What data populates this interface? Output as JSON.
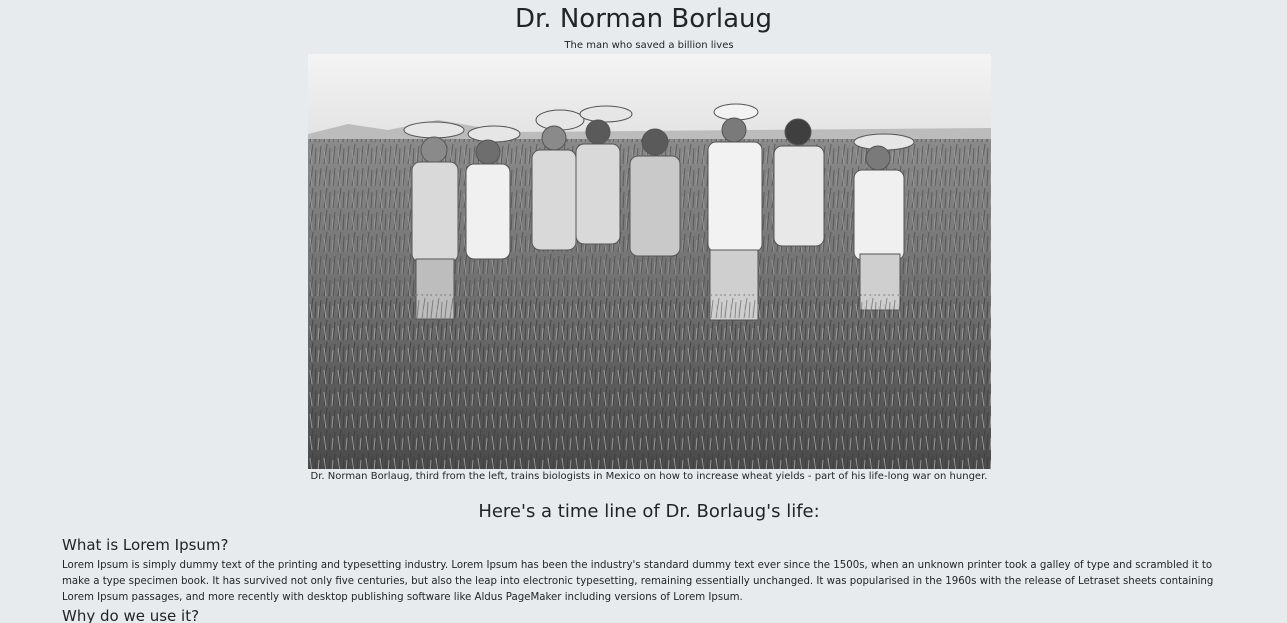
{
  "header": {
    "title": "Dr. Norman Borlaug",
    "subtitle": "The man who saved a billion lives"
  },
  "figure": {
    "caption": "Dr. Norman Borlaug, third from the left, trains biologists in Mexico on how to increase wheat yields - part of his life-long war on hunger."
  },
  "timeline": {
    "heading": "Here's a time line of Dr. Borlaug's life:",
    "sections": [
      {
        "heading": "What is Lorem Ipsum?",
        "body": "Lorem Ipsum is simply dummy text of the printing and typesetting industry. Lorem Ipsum has been the industry's standard dummy text ever since the 1500s, when an unknown printer took a galley of type and scrambled it to make a type specimen book. It has survived not only five centuries, but also the leap into electronic typesetting, remaining essentially unchanged. It was popularised in the 1960s with the release of Letraset sheets containing Lorem Ipsum passages, and more recently with desktop publishing software like Aldus PageMaker including versions of Lorem Ipsum."
      },
      {
        "heading": "Why do we use it?"
      }
    ]
  }
}
